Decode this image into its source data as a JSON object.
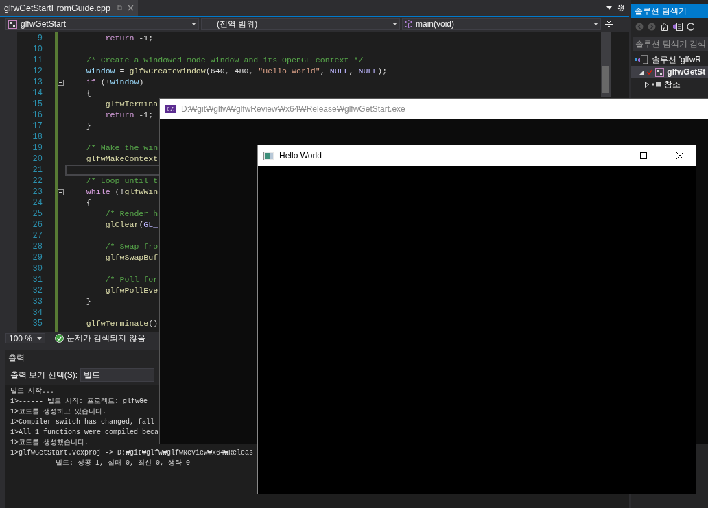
{
  "editor_tab": {
    "title": "glfwGetStartFromGuide.cpp",
    "selected": true
  },
  "navigation_bar": {
    "project": "glfwGetStart",
    "scope": "(전역 범위)",
    "member": "main(void)"
  },
  "code_lines": [
    {
      "number": "9",
      "tokens": [
        {
          "text": "        return",
          "kind": "keyword"
        },
        {
          "text": " -1;",
          "kind": "plain"
        }
      ]
    },
    {
      "number": "10"
    },
    {
      "number": "11",
      "tokens": [
        {
          "text": "    /* Create a windowed mode window and its OpenGL context */",
          "kind": "comment"
        }
      ]
    },
    {
      "number": "12",
      "tokens": [
        {
          "text": "    window",
          "kind": "variable"
        },
        {
          "text": " = ",
          "kind": "plain"
        },
        {
          "text": "glfwCreateWindow",
          "kind": "function"
        },
        {
          "text": "(640, 480, ",
          "kind": "plain"
        },
        {
          "text": "\"Hello World\"",
          "kind": "string"
        },
        {
          "text": ", ",
          "kind": "plain"
        },
        {
          "text": "NULL",
          "kind": "macro"
        },
        {
          "text": ", ",
          "kind": "plain"
        },
        {
          "text": "NULL",
          "kind": "macro"
        },
        {
          "text": ");",
          "kind": "plain"
        }
      ]
    },
    {
      "number": "13",
      "fold": true,
      "tokens": [
        {
          "text": "    if",
          "kind": "keyword"
        },
        {
          "text": " (!",
          "kind": "plain"
        },
        {
          "text": "window",
          "kind": "variable"
        },
        {
          "text": ")",
          "kind": "plain"
        }
      ]
    },
    {
      "number": "14",
      "tokens": [
        {
          "text": "    {",
          "kind": "plain"
        }
      ]
    },
    {
      "number": "15",
      "tokens": [
        {
          "text": "        glfwTermina",
          "kind": "function"
        }
      ]
    },
    {
      "number": "16",
      "tokens": [
        {
          "text": "        return",
          "kind": "keyword"
        },
        {
          "text": " -1;",
          "kind": "plain"
        }
      ]
    },
    {
      "number": "17",
      "tokens": [
        {
          "text": "    }",
          "kind": "plain"
        }
      ]
    },
    {
      "number": "18"
    },
    {
      "number": "19",
      "tokens": [
        {
          "text": "    /* Make the win",
          "kind": "comment"
        }
      ]
    },
    {
      "number": "20",
      "tokens": [
        {
          "text": "    glfwMakeContext",
          "kind": "function"
        }
      ]
    },
    {
      "number": "21",
      "current": true
    },
    {
      "number": "22",
      "tokens": [
        {
          "text": "    /* Loop until t",
          "kind": "comment"
        }
      ]
    },
    {
      "number": "23",
      "fold": true,
      "tokens": [
        {
          "text": "    while",
          "kind": "keyword"
        },
        {
          "text": " (!",
          "kind": "plain"
        },
        {
          "text": "glfwWin",
          "kind": "function"
        }
      ]
    },
    {
      "number": "24",
      "tokens": [
        {
          "text": "    {",
          "kind": "plain"
        }
      ]
    },
    {
      "number": "25",
      "tokens": [
        {
          "text": "        /* Render h",
          "kind": "comment"
        }
      ]
    },
    {
      "number": "26",
      "tokens": [
        {
          "text": "        glClear",
          "kind": "function"
        },
        {
          "text": "(",
          "kind": "plain"
        },
        {
          "text": "GL_",
          "kind": "macro"
        }
      ]
    },
    {
      "number": "27"
    },
    {
      "number": "28",
      "tokens": [
        {
          "text": "        /* Swap fro",
          "kind": "comment"
        }
      ]
    },
    {
      "number": "29",
      "tokens": [
        {
          "text": "        glfwSwapBuf",
          "kind": "function"
        }
      ]
    },
    {
      "number": "30"
    },
    {
      "number": "31",
      "tokens": [
        {
          "text": "        /* Poll for",
          "kind": "comment"
        }
      ]
    },
    {
      "number": "32",
      "tokens": [
        {
          "text": "        glfwPollEve",
          "kind": "function"
        }
      ]
    },
    {
      "number": "33",
      "tokens": [
        {
          "text": "    }",
          "kind": "plain"
        }
      ]
    },
    {
      "number": "34"
    },
    {
      "number": "35",
      "tokens": [
        {
          "text": "    glfwTerminate",
          "kind": "function"
        },
        {
          "text": "()",
          "kind": "plain"
        }
      ]
    }
  ],
  "status_bar": {
    "zoom": "100 %",
    "issues": "문제가 검색되지 않음"
  },
  "output_panel": {
    "title": "출력",
    "source_label": "출력 보기 선택(S):",
    "source": "빌드",
    "lines": [
      "빌드 시작...",
      "1>------ 빌드 시작: 프로젝트: glfwGe",
      "1>코드를 생성하고 있습니다.",
      "1>Compiler switch has changed, fall",
      "1>All 1 functions were compiled beca",
      "1>코드를 생성했습니다.",
      "1>glfwGetStart.vcxproj -> D:₩git₩glfw₩glfwReview₩x64₩Releas",
      "========== 빌드: 성공 1, 실패 0, 최신 0, 생략 0 =========="
    ]
  },
  "solution_explorer": {
    "title": "솔루션 탐색기",
    "search_placeholder": "솔루션 탐색기 검색",
    "tree": [
      {
        "label": "솔루션 'glfwR",
        "selected": false,
        "children": [
          {
            "label": "glfwGetSt",
            "selected": true,
            "expanded": true,
            "children": [
              {
                "label": "참조",
                "selected": false,
                "expanded": false
              }
            ]
          }
        ]
      }
    ]
  },
  "console_window": {
    "title": "D:₩git₩glfw₩glfwReview₩x64₩Release₩glfwGetStart.exe"
  },
  "app_window": {
    "title": "Hello World"
  }
}
